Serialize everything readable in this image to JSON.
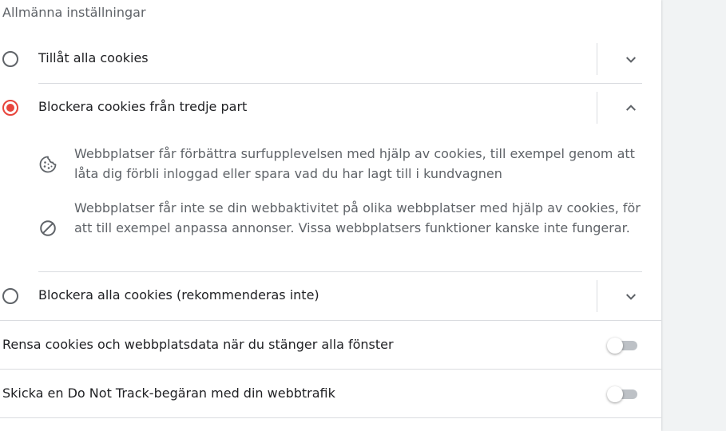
{
  "section": {
    "title": "Allmänna inställningar"
  },
  "cookie_options": [
    {
      "label": "Tillåt alla cookies",
      "selected": false,
      "expanded": false
    },
    {
      "label": "Blockera cookies från tredje part",
      "selected": true,
      "expanded": true
    },
    {
      "label": "Blockera alla cookies (rekommenderas inte)",
      "selected": false,
      "expanded": false
    }
  ],
  "details": [
    {
      "icon": "cookie-icon",
      "text": "Webbplatser får förbättra surfupplevelsen med hjälp av cookies, till exempel genom att låta dig förbli inloggad eller spara vad du har lagt till i kundvagnen"
    },
    {
      "icon": "block-icon",
      "text": "Webbplatser får inte se din webbaktivitet på olika webbplatser med hjälp av cookies, för att till exempel anpassa annonser. Vissa webbplatsers funktioner kanske inte fungerar."
    }
  ],
  "toggles": [
    {
      "label": "Rensa cookies och webbplatsdata när du stänger alla fönster",
      "on": false
    },
    {
      "label": "Skicka en Do Not Track-begäran med din webbtrafik",
      "on": false
    }
  ],
  "colors": {
    "accent": "#e8453c",
    "text": "#202124",
    "secondary_text": "#5f6368",
    "divider": "#dadce0"
  }
}
